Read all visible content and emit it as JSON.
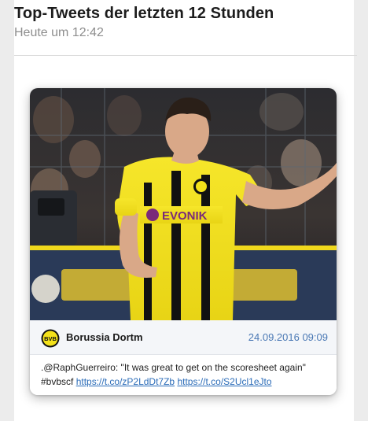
{
  "header": {
    "title": "Top-Tweets der letzten 12 Stunden",
    "timestamp": "Heute um 12:42"
  },
  "tweet": {
    "author": "Borussia Dortm",
    "date": "24.09.2016 09:09",
    "text": ".@RaphGuerreiro: \"It was great to get on the scoresheet again\"",
    "hashtag": "#bvbscf",
    "link1": "https://t.co/zP2LdDt7Zb",
    "link2": "https://t.co/S2Ucl1eJto",
    "logo_text": "BVB",
    "photo_sponsor": "EVONIK",
    "photo_badge": "BVB"
  },
  "colors": {
    "bvb_yellow": "#f4e21a",
    "link_blue": "#2b6cb8",
    "date_blue": "#4a78b4",
    "muted_gray": "#8e8e8e"
  }
}
